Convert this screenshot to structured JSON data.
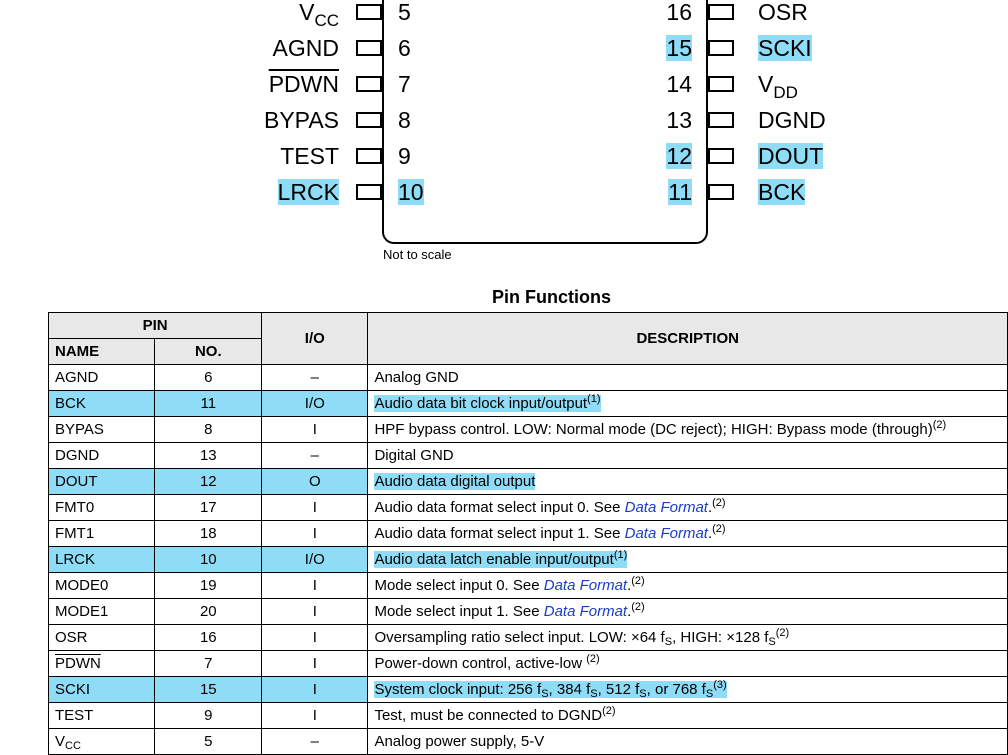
{
  "diagram": {
    "left_pins": [
      {
        "name": "V",
        "sub": "CC",
        "no": "5",
        "highlight": false
      },
      {
        "name": "AGND",
        "no": "6",
        "highlight": false
      },
      {
        "name": "PDWN",
        "no": "7",
        "highlight": false,
        "overline": true
      },
      {
        "name": "BYPAS",
        "no": "8",
        "highlight": false
      },
      {
        "name": "TEST",
        "no": "9",
        "highlight": false
      },
      {
        "name": "LRCK",
        "no": "10",
        "highlight": true
      }
    ],
    "right_pins": [
      {
        "name": "OSR",
        "no": "16",
        "highlight": false
      },
      {
        "name": "SCKI",
        "no": "15",
        "highlight": true
      },
      {
        "name": "V",
        "sub": "DD",
        "no": "14",
        "highlight": false
      },
      {
        "name": "DGND",
        "no": "13",
        "highlight": false
      },
      {
        "name": "DOUT",
        "no": "12",
        "highlight": true
      },
      {
        "name": "BCK",
        "no": "11",
        "highlight": true
      }
    ],
    "note": "Not to scale"
  },
  "table": {
    "title": "Pin Functions",
    "header_group": "PIN",
    "col_name": "NAME",
    "col_no": "NO.",
    "col_io": "I/O",
    "col_desc": "DESCRIPTION",
    "rows": [
      {
        "name": "AGND",
        "no": "6",
        "io": "–",
        "desc": "Analog GND",
        "hl": false
      },
      {
        "name": "BCK",
        "no": "11",
        "io": "I/O",
        "desc": "Audio data bit clock input/output",
        "sup": "(1)",
        "hl": true
      },
      {
        "name": "BYPAS",
        "no": "8",
        "io": "I",
        "desc": "HPF bypass control. LOW: Normal mode (DC reject); HIGH: Bypass mode (through)",
        "sup": "(2)",
        "hl": false
      },
      {
        "name": "DGND",
        "no": "13",
        "io": "–",
        "desc": "Digital GND",
        "hl": false
      },
      {
        "name": "DOUT",
        "no": "12",
        "io": "O",
        "desc": "Audio data digital output",
        "hl": true
      },
      {
        "name": "FMT0",
        "no": "17",
        "io": "I",
        "desc": "Audio data format select input 0. See ",
        "link": "Data Format",
        "after": ".",
        "sup": "(2)",
        "hl": false
      },
      {
        "name": "FMT1",
        "no": "18",
        "io": "I",
        "desc": "Audio data format select input 1. See ",
        "link": "Data Format",
        "after": ".",
        "sup": "(2)",
        "hl": false
      },
      {
        "name": "LRCK",
        "no": "10",
        "io": "I/O",
        "desc": "Audio data latch enable input/output",
        "sup": "(1)",
        "hl": true
      },
      {
        "name": "MODE0",
        "no": "19",
        "io": "I",
        "desc": "Mode select input 0. See ",
        "link": "Data Format",
        "after": ".",
        "sup": "(2)",
        "hl": false
      },
      {
        "name": "MODE1",
        "no": "20",
        "io": "I",
        "desc": "Mode select input 1. See ",
        "link": "Data Format",
        "after": ".",
        "sup": "(2)",
        "hl": false
      },
      {
        "name": "OSR",
        "no": "16",
        "io": "I",
        "desc": "Oversampling ratio select input. LOW: ×64 f",
        "sub1": "S",
        "desc2": ", HIGH: ×128 f",
        "sub2": "S",
        "sup": "(2)",
        "hl": false
      },
      {
        "name": "PDWN",
        "no": "7",
        "io": "I",
        "desc": "Power-down control, active-low ",
        "sup": "(2)",
        "hl": false,
        "overline": true
      },
      {
        "name": "SCKI",
        "no": "15",
        "io": "I",
        "desc": "System clock input: 256 f",
        "sub1": "S",
        "desc2": ", 384 f",
        "sub2": "S",
        "desc3": ", 512 f",
        "sub3": "S",
        "desc4": ", or 768 f",
        "sub4": "S",
        "sup": "(3)",
        "hl": true
      },
      {
        "name": "TEST",
        "no": "9",
        "io": "I",
        "desc": "Test, must be connected to DGND",
        "sup": "(2)",
        "hl": false
      },
      {
        "name": "V",
        "namesub": "CC",
        "no": "5",
        "io": "–",
        "desc": "Analog power supply, 5-V",
        "hl": false
      }
    ]
  }
}
